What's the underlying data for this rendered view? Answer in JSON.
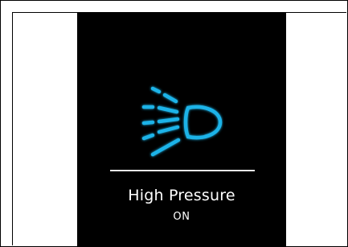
{
  "panel": {
    "title": "High Pressure",
    "state": "ON"
  },
  "icon": {
    "name": "high-pressure-headlight-icon",
    "color": "#1fb3e8"
  },
  "colors": {
    "screen_background": "#000000",
    "text": "#ffffff",
    "divider": "#e8e8e8"
  }
}
